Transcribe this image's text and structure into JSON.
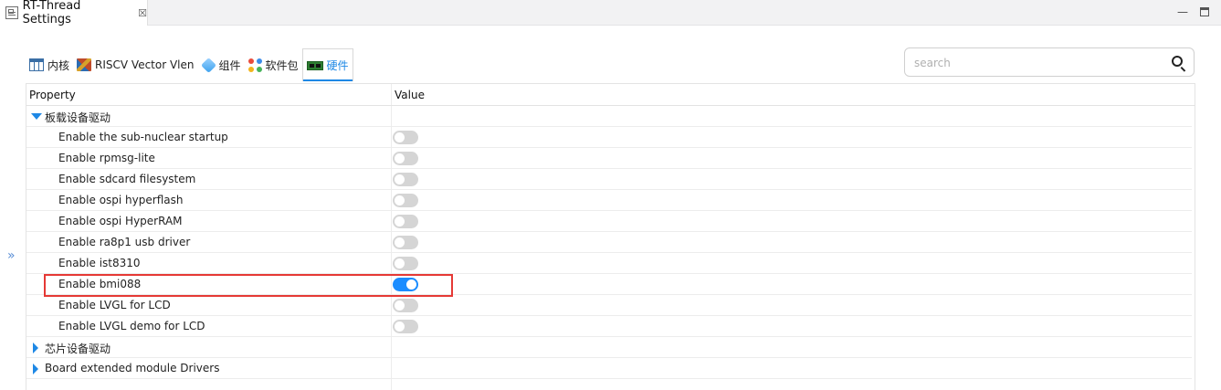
{
  "editor": {
    "tab_title": "RT-Thread Settings",
    "close_glyph": "☒",
    "minimize_glyph": "—"
  },
  "tool_tabs": [
    {
      "label": "内核",
      "icon": "kernel-icon",
      "active": false
    },
    {
      "label": "RISCV Vector Vlen",
      "icon": "riscv-icon",
      "active": false
    },
    {
      "label": "组件",
      "icon": "component-icon",
      "active": false
    },
    {
      "label": "软件包",
      "icon": "package-icon",
      "active": false
    },
    {
      "label": "硬件",
      "icon": "hardware-icon",
      "active": true
    }
  ],
  "search": {
    "placeholder": "search",
    "value": ""
  },
  "side_toggle": "»",
  "table": {
    "headers": {
      "property": "Property",
      "value": "Value"
    },
    "rows": [
      {
        "label": "板载设备驱动",
        "type": "group",
        "expanded": true
      },
      {
        "label": "Enable the sub-nuclear startup",
        "type": "child",
        "enabled": false
      },
      {
        "label": "Enable rpmsg-lite",
        "type": "child",
        "enabled": false
      },
      {
        "label": "Enable sdcard filesystem",
        "type": "child",
        "enabled": false
      },
      {
        "label": "Enable ospi hyperflash",
        "type": "child",
        "enabled": false
      },
      {
        "label": "Enable ospi HyperRAM",
        "type": "child",
        "enabled": false
      },
      {
        "label": "Enable ra8p1 usb driver",
        "type": "child",
        "enabled": false
      },
      {
        "label": "Enable ist8310",
        "type": "child",
        "enabled": false
      },
      {
        "label": "Enable bmi088",
        "type": "child",
        "enabled": true,
        "highlighted": true
      },
      {
        "label": "Enable LVGL for LCD",
        "type": "child",
        "enabled": false
      },
      {
        "label": "Enable LVGL demo for LCD",
        "type": "child",
        "enabled": false
      },
      {
        "label": "芯片设备驱动",
        "type": "group",
        "expanded": false
      },
      {
        "label": "Board extended module Drivers",
        "type": "group",
        "expanded": false
      }
    ]
  },
  "colors": {
    "accent": "#1e88e5",
    "toggle_on": "#1a8cff",
    "toggle_off": "#d5d5d5",
    "highlight_box": "#e53935"
  }
}
